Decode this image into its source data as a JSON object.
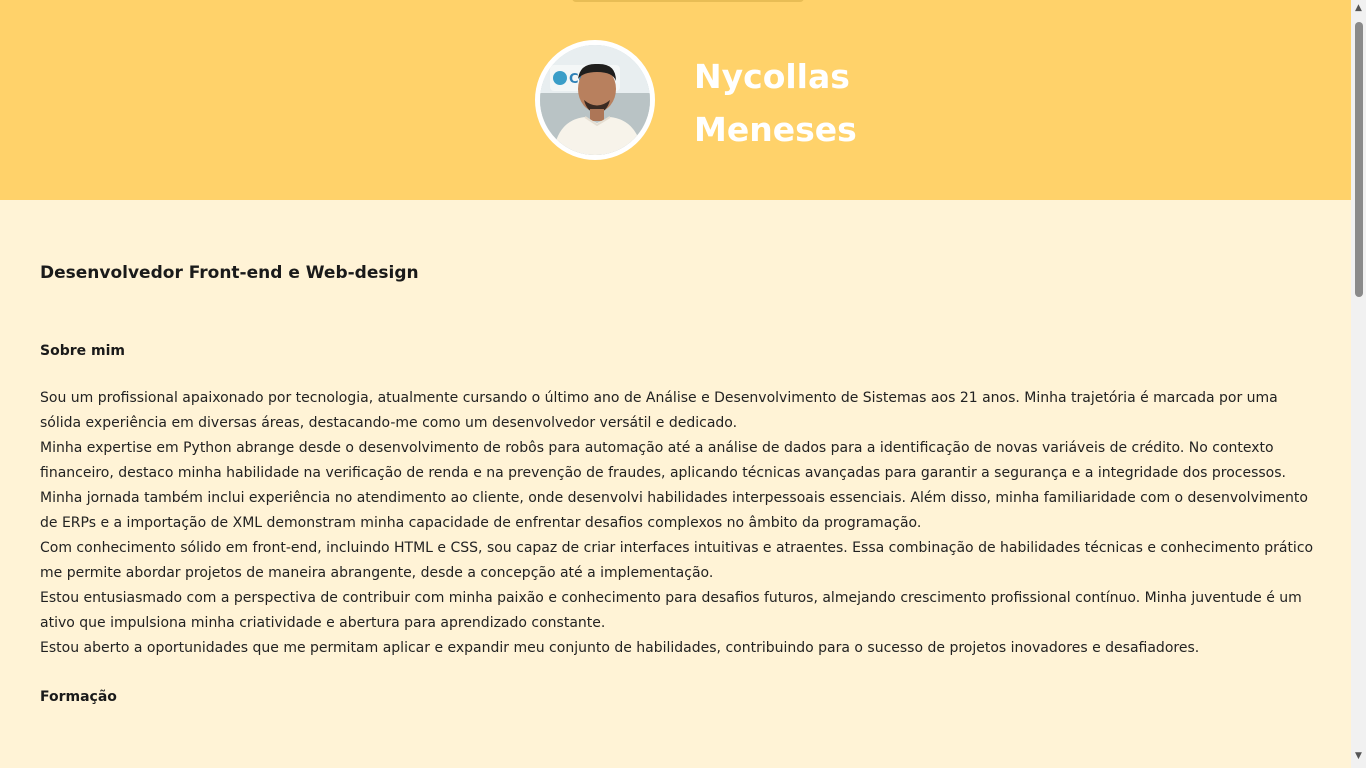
{
  "header": {
    "first_name": "Nycollas",
    "last_name": "Meneses",
    "background_color": "#ffd26a",
    "text_color": "#ffffff"
  },
  "avatar": {
    "icon": "profile-photo",
    "photo_sign_text": "Co..a"
  },
  "main": {
    "role": "Desenvolvedor Front-end e Web-design",
    "about_title": "Sobre mim",
    "about_paragraphs": [
      "Sou um profissional apaixonado por tecnologia, atualmente cursando o último ano de Análise e Desenvolvimento de Sistemas aos 21 anos. Minha trajetória é marcada por uma sólida experiência em diversas áreas, destacando-me como um desenvolvedor versátil e dedicado.",
      "Minha expertise em Python abrange desde o desenvolvimento de robôs para automação até a análise de dados para a identificação de novas variáveis de crédito. No contexto financeiro, destaco minha habilidade na verificação de renda e na prevenção de fraudes, aplicando técnicas avançadas para garantir a segurança e a integridade dos processos.",
      "Minha jornada também inclui experiência no atendimento ao cliente, onde desenvolvi habilidades interpessoais essenciais. Além disso, minha familiaridade com o desenvolvimento de ERPs e a importação de XML demonstram minha capacidade de enfrentar desafios complexos no âmbito da programação.",
      "Com conhecimento sólido em front-end, incluindo HTML e CSS, sou capaz de criar interfaces intuitivas e atraentes. Essa combinação de habilidades técnicas e conhecimento prático me permite abordar projetos de maneira abrangente, desde a concepção até a implementação.",
      "Estou entusiasmado com a perspectiva de contribuir com minha paixão e conhecimento para desafios futuros, almejando crescimento profissional contínuo. Minha juventude é um ativo que impulsiona minha criatividade e abertura para aprendizado constante.",
      "Estou aberto a oportunidades que me permitam aplicar e expandir meu conjunto de habilidades, contribuindo para o sucesso de projetos inovadores e desafiadores."
    ],
    "education_title": "Formação",
    "background_color": "#fff3d6"
  },
  "scrollbar": {
    "up_icon": "scroll-up-arrow-icon",
    "down_icon": "scroll-down-arrow-icon"
  }
}
